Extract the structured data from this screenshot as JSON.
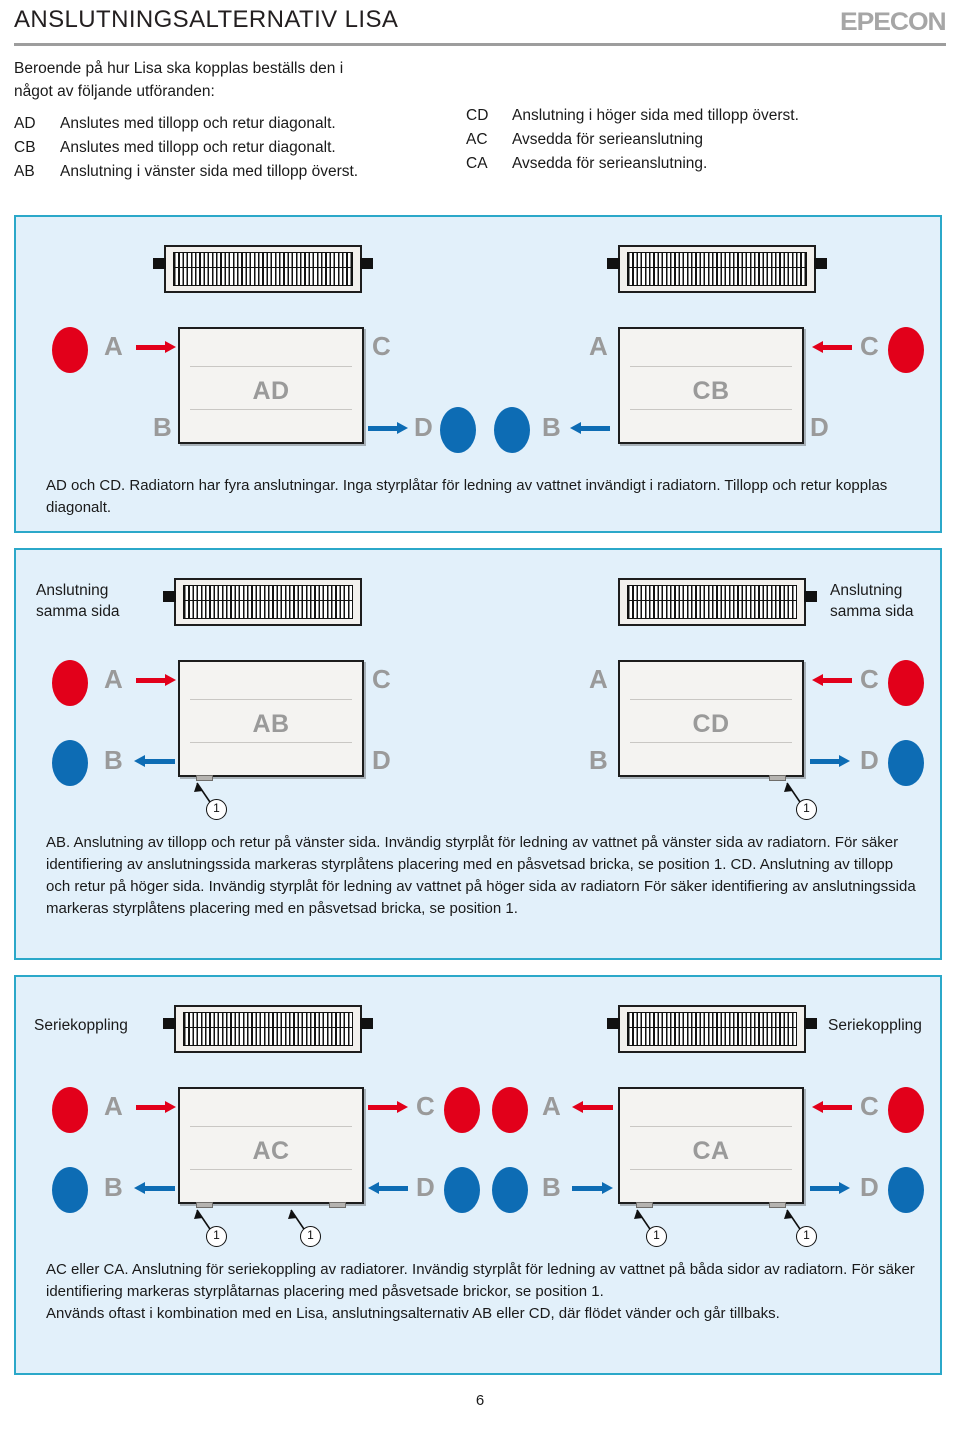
{
  "header": {
    "title": "ANSLUTNINGSALTERNATIV LISA",
    "logo": "EPECON"
  },
  "intro": {
    "lead": "Beroende på hur Lisa ska kopplas beställs den i\nnågot av följande utföranden:",
    "left_codes": [
      {
        "code": "AD",
        "text": "Anslutes med tillopp och retur diagonalt."
      },
      {
        "code": "CB",
        "text": "Anslutes med tillopp och retur diagonalt."
      },
      {
        "code": "AB",
        "text": "Anslutning i vänster sida med tillopp överst."
      }
    ],
    "right_codes": [
      {
        "code": "CD",
        "text": "Anslutning i höger sida med tillopp överst."
      },
      {
        "code": "AC",
        "text": "Avsedda för serieanslutning"
      },
      {
        "code": "CA",
        "text": "Avsedda för serieanslutning."
      }
    ]
  },
  "panels": [
    {
      "id": "panel-ad",
      "left_unit": {
        "label": "AD"
      },
      "right_unit": {
        "label": "CB"
      },
      "caption": "AD och CD. Radiatorn har fyra anslutningar. Inga styrplåtar för ledning av vattnet invändigt i radiatorn. Tillopp och retur kopplas diagonalt.",
      "port_a": "A",
      "port_b": "B",
      "port_c": "C",
      "port_d": "D"
    },
    {
      "id": "panel-ab",
      "left_unit": {
        "label": "AB",
        "note": "Anslutning\nsamma sida"
      },
      "right_unit": {
        "label": "CD",
        "note": "Anslutning\nsamma sida"
      },
      "caption": "AB. Anslutning av tillopp och retur på vänster sida. Invändig styrplåt för ledning av vattnet på vänster sida av radiatorn. För säker identifiering av anslutningssida markeras styrplåtens placering med en påsvetsad bricka, se position 1.\nCD. Anslutning av tillopp och retur på höger sida. Invändig styrplåt för ledning av vattnet på höger sida av radiatorn För säker identifiering av anslutningssida markeras styrplåtens placering med en påsvetsad bricka, se position 1.",
      "port_a": "A",
      "port_b": "B",
      "port_c": "C",
      "port_d": "D",
      "callout": "1"
    },
    {
      "id": "panel-ac",
      "left_unit": {
        "label": "AC",
        "note": "Seriekoppling"
      },
      "right_unit": {
        "label": "CA",
        "note": "Seriekoppling"
      },
      "caption": "AC eller CA. Anslutning för seriekoppling av radiatorer. Invändig styrplåt för ledning av vattnet på båda sidor av radiatorn. För säker identifiering markeras styrplåtarnas placering med påsvetsade brickor, se position 1.\nAnvänds oftast i kombination med en Lisa, anslutningsalternativ AB eller CD, där flödet vänder och går tillbaks.",
      "port_a": "A",
      "port_b": "B",
      "port_c": "C",
      "port_d": "D",
      "callout": "1"
    }
  ],
  "footer": {
    "page_number": "6"
  },
  "colors": {
    "panel_bg": "#e2f0fa",
    "panel_border": "#2ba8c9",
    "supply_red": "#e2001a",
    "return_blue": "#0d6cb4",
    "label_gray": "#9a9a9a",
    "logo_gray": "#a6a6a6"
  }
}
